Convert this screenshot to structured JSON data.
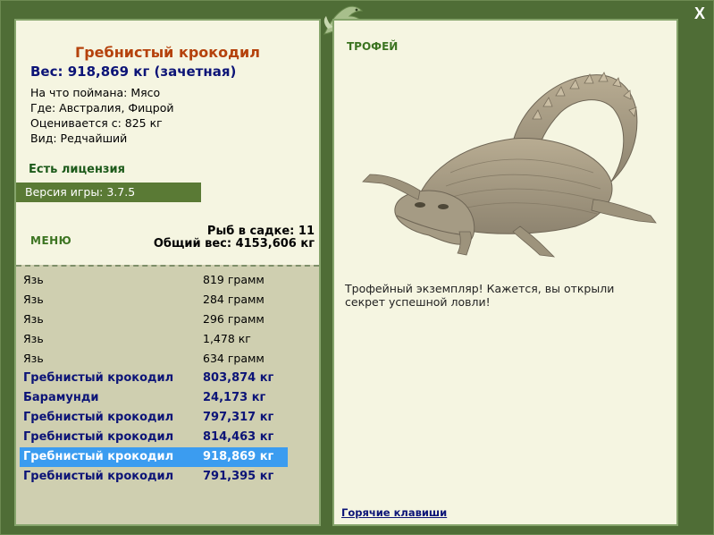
{
  "window": {
    "close_label": "X"
  },
  "catch": {
    "title": "Гребнистый крокодил",
    "weight_line": "Вес: 918,869 кг (зачетная)",
    "details": [
      "На что поймана: Мясо",
      "Где: Австралия, Фицрой",
      "Оценивается с: 825 кг",
      "Вид: Редчайший"
    ],
    "license": "Есть лицензия",
    "version": "Версия игры: 3.7.5"
  },
  "menu_label": "МЕНЮ",
  "stats": {
    "fish_in_keepnet": "Рыб в садке: 11",
    "total_weight": "Общий вес: 4153,606 кг"
  },
  "fish_list": [
    {
      "name": "Язь",
      "weight": "819 грамм",
      "trophy": false
    },
    {
      "name": "Язь",
      "weight": "284 грамм",
      "trophy": false
    },
    {
      "name": "Язь",
      "weight": "296 грамм",
      "trophy": false
    },
    {
      "name": "Язь",
      "weight": "1,478 кг",
      "trophy": false
    },
    {
      "name": "Язь",
      "weight": "634 грамм",
      "trophy": false
    },
    {
      "name": "Гребнистый крокодил",
      "weight": "803,874 кг",
      "trophy": true
    },
    {
      "name": "Барамунди",
      "weight": "24,173 кг",
      "trophy": true
    },
    {
      "name": "Гребнистый крокодил",
      "weight": "797,317 кг",
      "trophy": true
    },
    {
      "name": "Гребнистый крокодил",
      "weight": "814,463 кг",
      "trophy": true
    },
    {
      "name": "Гребнистый крокодил",
      "weight": "918,869 кг",
      "trophy": true,
      "selected": true
    },
    {
      "name": "Гребнистый крокодил",
      "weight": "791,395 кг",
      "trophy": true
    }
  ],
  "trophy_panel": {
    "label": "ТРОФЕЙ",
    "image_icon": "crocodile-image",
    "description": "Трофейный экземпляр! Кажется, вы открыли секрет успешной ловли!",
    "hotkeys_link": "Горячие клавиши"
  },
  "colors": {
    "frame": "#4f6d36",
    "panel_bg": "#f5f5e1",
    "list_bg": "#cfcfb0",
    "title": "#b5420c",
    "trophy_text": "#0c1477",
    "selection": "#3b9cf0",
    "version_bar": "#5a7a35"
  }
}
